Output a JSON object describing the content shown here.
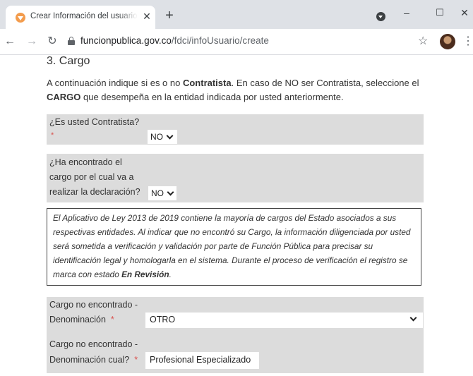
{
  "browser": {
    "tab_title": "Crear Información del usuario - S",
    "new_tab": "+",
    "url_host": "funcionpublica.gov.co",
    "url_path": "/fdci/infoUsuario/create",
    "minimize": "–",
    "maximize": "☐",
    "close": "✕"
  },
  "page": {
    "section_title": "3. Cargo",
    "intro_part1": "A continuación indique si es o no ",
    "intro_bold1": "Contratista",
    "intro_part2": ". En caso de NO ser Contratista, seleccione el ",
    "intro_bold2": "CARGO",
    "intro_part3": " que desempeña en la entidad indicada por usted anteriormente.",
    "contratista": {
      "label": "¿Es usted Contratista?",
      "required": "*",
      "value": "NO"
    },
    "cargo_encontrado": {
      "label_line1": "¿Ha encontrado el",
      "label_line2": "cargo por el cual va a",
      "label_line3": "realizar la declaración?",
      "value": "NO"
    },
    "notice": {
      "text": "El Aplicativo de Ley 2013 de 2019 contiene la mayoría de cargos del Estado asociados a sus respectivas entidades. Al indicar que no encontró su Cargo, la información diligenciada por usted será sometida a verificación y validación por parte de Función Pública para precisar su identificación legal y homologarla en el sistema. Durante el proceso de verificación el registro se marca con estado ",
      "bold": "En Revisión",
      "end": "."
    },
    "denominacion": {
      "label_line1": "Cargo no encontrado -",
      "label_line2": "Denominación",
      "required": "*",
      "value": "OTRO"
    },
    "denominacion_cual": {
      "label_line1": "Cargo no encontrado -",
      "label_line2": "Denominación cual?",
      "required": "*",
      "value": "Profesional Especializado"
    }
  }
}
